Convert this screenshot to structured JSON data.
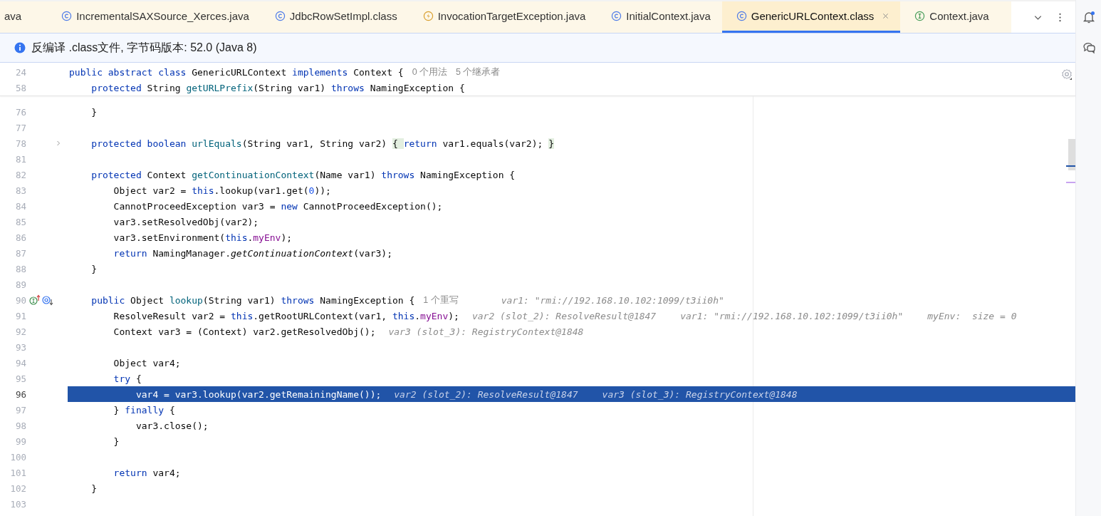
{
  "tabs": [
    {
      "label": "ava",
      "kind": "none",
      "selected": false
    },
    {
      "label": "IncrementalSAXSource_Xerces.java",
      "kind": "class",
      "selected": false
    },
    {
      "label": "JdbcRowSetImpl.class",
      "kind": "class",
      "selected": false
    },
    {
      "label": "InvocationTargetException.java",
      "kind": "exception",
      "selected": false
    },
    {
      "label": "InitialContext.java",
      "kind": "class",
      "selected": false
    },
    {
      "label": "GenericURLContext.class",
      "kind": "class",
      "selected": true
    },
    {
      "label": "Context.java",
      "kind": "interface",
      "selected": false
    }
  ],
  "banner": {
    "text": "反编译 .class文件, 字节码版本: 52.0 (Java 8)"
  },
  "sticky_lines": [
    {
      "num": "24",
      "tokens": [
        {
          "text": "public abstract class ",
          "kind": "kw"
        },
        {
          "text": "GenericURLContext ",
          "kind": "p"
        },
        {
          "text": "implements ",
          "kind": "kw"
        },
        {
          "text": "Context {",
          "kind": "p"
        }
      ],
      "hints": [
        "0 个用法",
        "5 个继承者"
      ]
    },
    {
      "num": "58",
      "tokens": [
        {
          "text": "    protected ",
          "kind": "kw"
        },
        {
          "text": "String ",
          "kind": "p"
        },
        {
          "text": "getURLPrefix",
          "kind": "m"
        },
        {
          "text": "(String var1) ",
          "kind": "p"
        },
        {
          "text": "throws ",
          "kind": "kw"
        },
        {
          "text": "NamingException {",
          "kind": "p"
        }
      ]
    }
  ],
  "lines": [
    {
      "num": "76",
      "selected": false,
      "folded": false,
      "marked": false,
      "tokens": [
        {
          "text": "    }",
          "kind": "p"
        }
      ]
    },
    {
      "num": "77",
      "selected": false,
      "folded": false,
      "marked": false
    },
    {
      "num": "78",
      "selected": false,
      "folded": true,
      "marked": false,
      "tokens": [
        {
          "text": "    protected boolean ",
          "kind": "kw"
        },
        {
          "text": "urlEquals",
          "kind": "m"
        },
        {
          "text": "(String var1, String var2) ",
          "kind": "p"
        },
        {
          "text": "{ ",
          "kind": "f"
        },
        {
          "text": "return ",
          "kind": "kw"
        },
        {
          "text": "var1.equals(var2); ",
          "kind": "p"
        },
        {
          "text": "}",
          "kind": "f"
        }
      ]
    },
    {
      "num": "81",
      "selected": false,
      "folded": false,
      "marked": false
    },
    {
      "num": "82",
      "selected": false,
      "folded": false,
      "marked": false,
      "tokens": [
        {
          "text": "    protected ",
          "kind": "kw"
        },
        {
          "text": "Context ",
          "kind": "p"
        },
        {
          "text": "getContinuationContext",
          "kind": "m"
        },
        {
          "text": "(Name var1) ",
          "kind": "p"
        },
        {
          "text": "throws ",
          "kind": "kw"
        },
        {
          "text": "NamingException {",
          "kind": "p"
        }
      ]
    },
    {
      "num": "83",
      "selected": false,
      "folded": false,
      "marked": false,
      "tokens": [
        {
          "text": "        Object var2 = ",
          "kind": "p"
        },
        {
          "text": "this",
          "kind": "kw"
        },
        {
          "text": ".lookup(var1.get(",
          "kind": "p"
        },
        {
          "text": "0",
          "kind": "n"
        },
        {
          "text": "));",
          "kind": "p"
        }
      ]
    },
    {
      "num": "84",
      "selected": false,
      "folded": false,
      "marked": false,
      "tokens": [
        {
          "text": "        CannotProceedException var3 = ",
          "kind": "p"
        },
        {
          "text": "new ",
          "kind": "kw"
        },
        {
          "text": "CannotProceedException();",
          "kind": "p"
        }
      ]
    },
    {
      "num": "85",
      "selected": false,
      "folded": false,
      "marked": false,
      "tokens": [
        {
          "text": "        var3.setResolvedObj(var2);",
          "kind": "p"
        }
      ]
    },
    {
      "num": "86",
      "selected": false,
      "folded": false,
      "marked": false,
      "tokens": [
        {
          "text": "        var3.setEnvironment(",
          "kind": "p"
        },
        {
          "text": "this",
          "kind": "kw"
        },
        {
          "text": ".",
          "kind": "p"
        },
        {
          "text": "myEnv",
          "kind": "fd"
        },
        {
          "text": ");",
          "kind": "p"
        }
      ]
    },
    {
      "num": "87",
      "selected": false,
      "folded": false,
      "marked": false,
      "tokens": [
        {
          "text": "        return ",
          "kind": "kw"
        },
        {
          "text": "NamingManager.",
          "kind": "p"
        },
        {
          "text": "getContinuationContext",
          "kind": "it"
        },
        {
          "text": "(var3);",
          "kind": "p"
        }
      ]
    },
    {
      "num": "88",
      "selected": false,
      "folded": false,
      "marked": false,
      "tokens": [
        {
          "text": "    }",
          "kind": "p"
        }
      ]
    },
    {
      "num": "89",
      "selected": false,
      "folded": false,
      "marked": false
    },
    {
      "num": "90",
      "selected": false,
      "folded": false,
      "marked": true,
      "tokens": [
        {
          "text": "    public ",
          "kind": "kw"
        },
        {
          "text": "Object ",
          "kind": "p"
        },
        {
          "text": "lookup",
          "kind": "m"
        },
        {
          "text": "(String var1) ",
          "kind": "p"
        },
        {
          "text": "throws ",
          "kind": "kw"
        },
        {
          "text": "NamingException {",
          "kind": "p"
        }
      ],
      "hints": [
        "1 个重写"
      ],
      "debug": [
        "var1: \"rmi://192.168.10.102:1099/t3ii0h\""
      ]
    },
    {
      "num": "91",
      "selected": false,
      "folded": false,
      "marked": false,
      "tokens": [
        {
          "text": "        ResolveResult var2 = ",
          "kind": "p"
        },
        {
          "text": "this",
          "kind": "kw"
        },
        {
          "text": ".getRootURLContext(var1, ",
          "kind": "p"
        },
        {
          "text": "this",
          "kind": "kw"
        },
        {
          "text": ".",
          "kind": "p"
        },
        {
          "text": "myEnv",
          "kind": "fd"
        },
        {
          "text": ");",
          "kind": "p"
        }
      ],
      "debug": [
        "var2 (slot_2): ResolveResult@1847",
        "var1: \"rmi://192.168.10.102:1099/t3ii0h\"",
        "myEnv:  size = 0"
      ]
    },
    {
      "num": "92",
      "selected": false,
      "folded": false,
      "marked": false,
      "tokens": [
        {
          "text": "        Context var3 = (Context) var2.getResolvedObj();",
          "kind": "p"
        }
      ],
      "debug": [
        "var3 (slot_3): RegistryContext@1848"
      ]
    },
    {
      "num": "93",
      "selected": false,
      "folded": false,
      "marked": false
    },
    {
      "num": "94",
      "selected": false,
      "folded": false,
      "marked": false,
      "tokens": [
        {
          "text": "        Object var4;",
          "kind": "p"
        }
      ]
    },
    {
      "num": "95",
      "selected": false,
      "folded": false,
      "marked": false,
      "tokens": [
        {
          "text": "        try ",
          "kind": "kw"
        },
        {
          "text": "{",
          "kind": "p"
        }
      ]
    },
    {
      "num": "96",
      "selected": true,
      "folded": false,
      "marked": false,
      "tokens": [
        {
          "text": "            var4 = var3.lookup(var2.getRemainingName());",
          "kind": "p"
        }
      ],
      "debug": [
        "var2 (slot_2): ResolveResult@1847",
        "var3 (slot_3): RegistryContext@1848"
      ]
    },
    {
      "num": "97",
      "selected": false,
      "folded": false,
      "marked": false,
      "tokens": [
        {
          "text": "        } ",
          "kind": "p"
        },
        {
          "text": "finally ",
          "kind": "kw"
        },
        {
          "text": "{",
          "kind": "p"
        }
      ]
    },
    {
      "num": "98",
      "selected": false,
      "folded": false,
      "marked": false,
      "tokens": [
        {
          "text": "            var3.close();",
          "kind": "p"
        }
      ]
    },
    {
      "num": "99",
      "selected": false,
      "folded": false,
      "marked": false,
      "tokens": [
        {
          "text": "        }",
          "kind": "p"
        }
      ]
    },
    {
      "num": "100",
      "selected": false,
      "folded": false,
      "marked": false
    },
    {
      "num": "101",
      "selected": false,
      "folded": false,
      "marked": false,
      "tokens": [
        {
          "text": "        return ",
          "kind": "kw"
        },
        {
          "text": "var4;",
          "kind": "p"
        }
      ]
    },
    {
      "num": "102",
      "selected": false,
      "folded": false,
      "marked": false,
      "tokens": [
        {
          "text": "    }",
          "kind": "p"
        }
      ]
    },
    {
      "num": "103",
      "selected": false,
      "folded": false,
      "marked": false
    }
  ]
}
